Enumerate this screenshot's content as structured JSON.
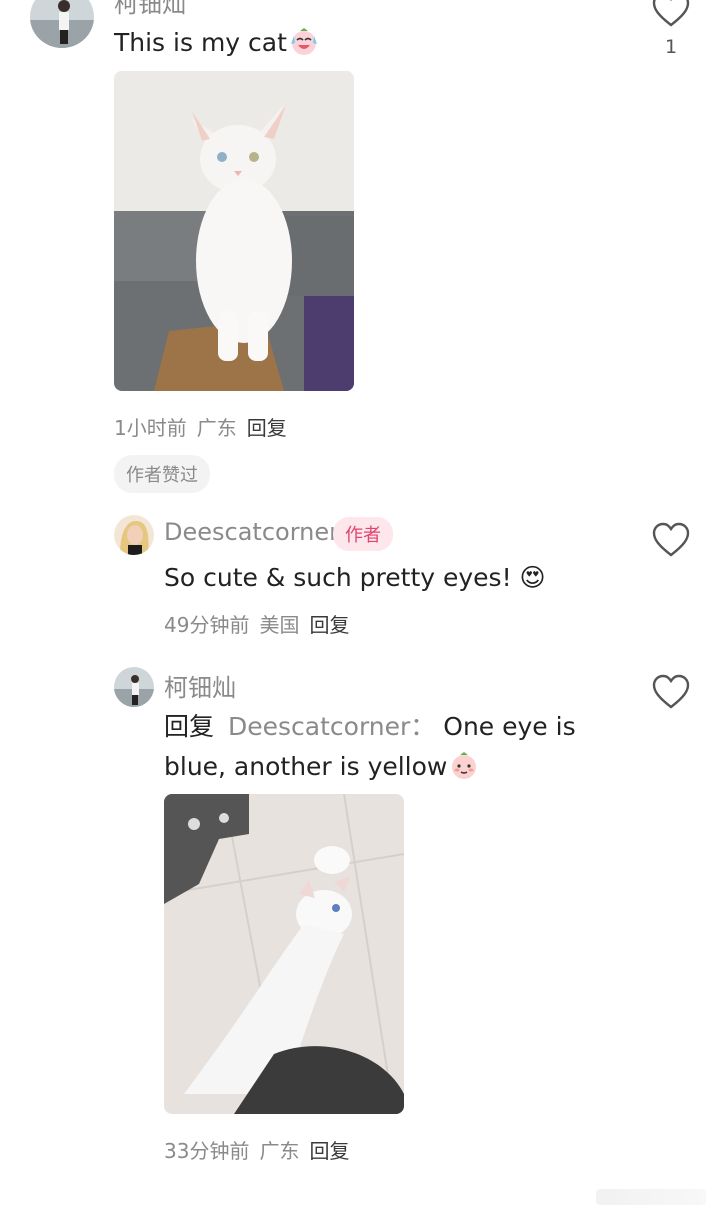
{
  "comments": [
    {
      "username": "柯钿灿",
      "text": "This is my cat",
      "emoji_icon": "laughing-crying-emoji",
      "meta_time": "1小时前",
      "meta_location": "广东",
      "meta_reply": "回复",
      "like_count": "1",
      "author_liked_badge": "作者赞过"
    },
    {
      "username": "Deescatcorner",
      "author_badge": "作者",
      "text": "So cute & such pretty eyes! 😍",
      "meta_time": "49分钟前",
      "meta_location": "美国",
      "meta_reply": "回复"
    },
    {
      "username": "柯钿灿",
      "reply_word": "回复",
      "reply_to": "Deescatcorner：",
      "text_line1": "One eye is",
      "text_line2": "blue, another is yellow",
      "emoji_icon": "shy-face-emoji",
      "meta_time": "33分钟前",
      "meta_location": "广东",
      "meta_reply": "回复"
    }
  ],
  "colors": {
    "meta_gray": "#8a8a8a",
    "author_pink": "#e0456d",
    "badge_bg": "#fde6ec"
  }
}
